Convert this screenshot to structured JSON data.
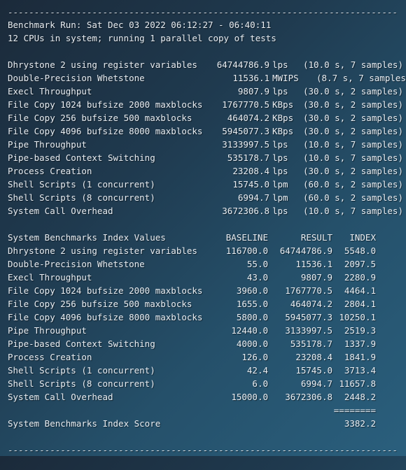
{
  "window": {
    "dash_line": "--------------------------------------------------------------------------"
  },
  "header": {
    "run_line": "Benchmark Run: Sat Dec 03 2022 06:12:27 - 06:40:11",
    "cpu_line": "12 CPUs in system; running 1 parallel copy of tests"
  },
  "run_results": [
    {
      "test": "Dhrystone 2 using register variables",
      "value": "64744786.9",
      "unit": "lps",
      "note": "(10.0 s, 7 samples)"
    },
    {
      "test": "Double-Precision Whetstone",
      "value": "11536.1",
      "unit": "MWIPS",
      "note": "(8.7 s, 7 samples)"
    },
    {
      "test": "Execl Throughput",
      "value": "9807.9",
      "unit": "lps",
      "note": "(30.0 s, 2 samples)"
    },
    {
      "test": "File Copy 1024 bufsize 2000 maxblocks",
      "value": "1767770.5",
      "unit": "KBps",
      "note": "(30.0 s, 2 samples)"
    },
    {
      "test": "File Copy 256 bufsize 500 maxblocks",
      "value": "464074.2",
      "unit": "KBps",
      "note": "(30.0 s, 2 samples)"
    },
    {
      "test": "File Copy 4096 bufsize 8000 maxblocks",
      "value": "5945077.3",
      "unit": "KBps",
      "note": "(30.0 s, 2 samples)"
    },
    {
      "test": "Pipe Throughput",
      "value": "3133997.5",
      "unit": "lps",
      "note": "(10.0 s, 7 samples)"
    },
    {
      "test": "Pipe-based Context Switching",
      "value": "535178.7",
      "unit": "lps",
      "note": "(10.0 s, 7 samples)"
    },
    {
      "test": "Process Creation",
      "value": "23208.4",
      "unit": "lps",
      "note": "(30.0 s, 2 samples)"
    },
    {
      "test": "Shell Scripts (1 concurrent)",
      "value": "15745.0",
      "unit": "lpm",
      "note": "(60.0 s, 2 samples)"
    },
    {
      "test": "Shell Scripts (8 concurrent)",
      "value": "6994.7",
      "unit": "lpm",
      "note": "(60.0 s, 2 samples)"
    },
    {
      "test": "System Call Overhead",
      "value": "3672306.8",
      "unit": "lps",
      "note": "(10.0 s, 7 samples)"
    }
  ],
  "index_table": {
    "title": "System Benchmarks Index Values",
    "col_baseline": "BASELINE",
    "col_result": "RESULT",
    "col_index": "INDEX",
    "rows": [
      {
        "test": "Dhrystone 2 using register variables",
        "baseline": "116700.0",
        "result": "64744786.9",
        "index": "5548.0"
      },
      {
        "test": "Double-Precision Whetstone",
        "baseline": "55.0",
        "result": "11536.1",
        "index": "2097.5"
      },
      {
        "test": "Execl Throughput",
        "baseline": "43.0",
        "result": "9807.9",
        "index": "2280.9"
      },
      {
        "test": "File Copy 1024 bufsize 2000 maxblocks",
        "baseline": "3960.0",
        "result": "1767770.5",
        "index": "4464.1"
      },
      {
        "test": "File Copy 256 bufsize 500 maxblocks",
        "baseline": "1655.0",
        "result": "464074.2",
        "index": "2804.1"
      },
      {
        "test": "File Copy 4096 bufsize 8000 maxblocks",
        "baseline": "5800.0",
        "result": "5945077.3",
        "index": "10250.1"
      },
      {
        "test": "Pipe Throughput",
        "baseline": "12440.0",
        "result": "3133997.5",
        "index": "2519.3"
      },
      {
        "test": "Pipe-based Context Switching",
        "baseline": "4000.0",
        "result": "535178.7",
        "index": "1337.9"
      },
      {
        "test": "Process Creation",
        "baseline": "126.0",
        "result": "23208.4",
        "index": "1841.9"
      },
      {
        "test": "Shell Scripts (1 concurrent)",
        "baseline": "42.4",
        "result": "15745.0",
        "index": "3713.4"
      },
      {
        "test": "Shell Scripts (8 concurrent)",
        "baseline": "6.0",
        "result": "6994.7",
        "index": "11657.8"
      },
      {
        "test": "System Call Overhead",
        "baseline": "15000.0",
        "result": "3672306.8",
        "index": "2448.2"
      }
    ],
    "separator": "========",
    "score_label": "System Benchmarks Index Score",
    "score_value": "3382.2"
  }
}
